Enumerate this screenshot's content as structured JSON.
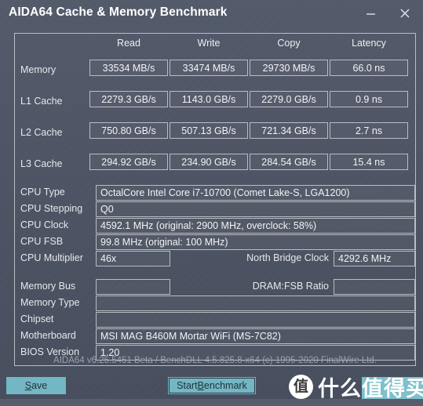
{
  "window": {
    "title": "AIDA64 Cache & Memory Benchmark",
    "minimize_icon": "minimize-icon",
    "close_icon": "close-icon"
  },
  "benchmark": {
    "columns": [
      "Read",
      "Write",
      "Copy",
      "Latency"
    ],
    "rows": [
      {
        "label": "Memory",
        "read": "33534 MB/s",
        "write": "33474 MB/s",
        "copy": "29730 MB/s",
        "latency": "66.0 ns"
      },
      {
        "label": "L1 Cache",
        "read": "2279.3 GB/s",
        "write": "1143.0 GB/s",
        "copy": "2279.0 GB/s",
        "latency": "0.9 ns"
      },
      {
        "label": "L2 Cache",
        "read": "750.80 GB/s",
        "write": "507.13 GB/s",
        "copy": "721.34 GB/s",
        "latency": "2.7 ns"
      },
      {
        "label": "L3 Cache",
        "read": "294.92 GB/s",
        "write": "234.90 GB/s",
        "copy": "284.54 GB/s",
        "latency": "15.4 ns"
      }
    ]
  },
  "cpu_info": {
    "type_label": "CPU Type",
    "type_value": "OctalCore Intel Core i7-10700  (Comet Lake-S, LGA1200)",
    "stepping_label": "CPU Stepping",
    "stepping_value": "Q0",
    "clock_label": "CPU Clock",
    "clock_value": "4592.1 MHz  (original: 2900 MHz, overclock: 58%)",
    "fsb_label": "CPU FSB",
    "fsb_value": "99.8 MHz  (original: 100 MHz)",
    "multiplier_label": "CPU Multiplier",
    "multiplier_value": "46x",
    "north_bridge_label": "North Bridge Clock",
    "north_bridge_value": "4292.6 MHz"
  },
  "system_info": {
    "memory_bus_label": "Memory Bus",
    "memory_bus_value": "",
    "dram_fsb_ratio_label": "DRAM:FSB Ratio",
    "dram_fsb_ratio_value": "",
    "memory_type_label": "Memory Type",
    "memory_type_value": "",
    "chipset_label": "Chipset",
    "chipset_value": "",
    "motherboard_label": "Motherboard",
    "motherboard_value": "MSI MAG B460M Mortar WiFi (MS-7C82)",
    "bios_label": "BIOS Version",
    "bios_value": "1.20"
  },
  "footer": {
    "version_text": "AIDA64 v6.25.5451 Beta / BenchDLL 4.5.825.8-x64  (c) 1995-2020 FinalWire Ltd.",
    "save_accel": "S",
    "save_rest": "ave",
    "benchmark_prefix": "Start ",
    "benchmark_accel": "B",
    "benchmark_rest": "enchmark"
  },
  "watermark": {
    "badge": "值",
    "text_plain": "什么",
    "text_highlight": "值得买"
  },
  "colors": {
    "window_bg": "#4d5463",
    "panel_border": "#b9bdc4",
    "accent_button": "#73b6c4",
    "text_primary": "#e8eaee",
    "text_muted": "#9aa2ae"
  }
}
